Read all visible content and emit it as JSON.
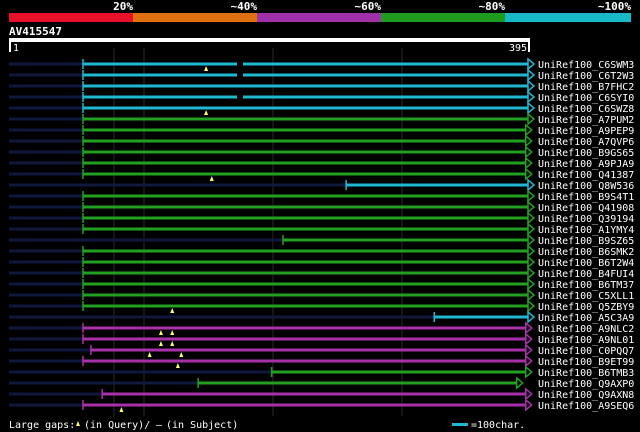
{
  "scale_bar": {
    "segments": [
      {
        "label": "20%",
        "color": "#e8102a"
      },
      {
        "label": "~40%",
        "color": "#e07010"
      },
      {
        "label": "~60%",
        "color": "#a030a8"
      },
      {
        "label": "~80%",
        "color": "#1e9a1e"
      },
      {
        "label": "~100%",
        "color": "#18b8c8"
      }
    ]
  },
  "query": {
    "id": "AV415547",
    "start": "1",
    "end": "395"
  },
  "colors": {
    "cyan": "#20b8d0",
    "green": "#22a022",
    "purple": "#a830a8",
    "navy": "#101840",
    "marker": "#ffff66",
    "grid": "#2a2a2a"
  },
  "hits": [
    {
      "name": "UniRef100_C6SWM3",
      "color": "cyan",
      "start": 1,
      "end": 395,
      "nav_from": 1,
      "marks": [
        [
          110,
          "tri"
        ],
        [
          140,
          "dash"
        ]
      ]
    },
    {
      "name": "UniRef100_C6T2W3",
      "color": "cyan",
      "start": 1,
      "end": 395,
      "nav_from": 1,
      "marks": [
        [
          140,
          "dash"
        ]
      ]
    },
    {
      "name": "UniRef100_B7FHC2",
      "color": "cyan",
      "start": 1,
      "end": 395,
      "nav_from": 1,
      "marks": []
    },
    {
      "name": "UniRef100_C6SYI0",
      "color": "cyan",
      "start": 1,
      "end": 395,
      "nav_from": 1,
      "marks": [
        [
          140,
          "dash"
        ]
      ]
    },
    {
      "name": "UniRef100_C6SWZ8",
      "color": "cyan",
      "start": 1,
      "end": 395,
      "nav_from": 1,
      "marks": [
        [
          110,
          "tri"
        ]
      ]
    },
    {
      "name": "UniRef100_A7PUM2",
      "color": "green",
      "start": 1,
      "end": 395,
      "nav_from": 1,
      "marks": []
    },
    {
      "name": "UniRef100_A9PEP9",
      "color": "green",
      "start": 1,
      "end": 393,
      "nav_from": 1,
      "marks": []
    },
    {
      "name": "UniRef100_A7QVP6",
      "color": "green",
      "start": 1,
      "end": 393,
      "nav_from": 1,
      "marks": []
    },
    {
      "name": "UniRef100_B9GS65",
      "color": "green",
      "start": 1,
      "end": 393,
      "nav_from": 1,
      "marks": []
    },
    {
      "name": "UniRef100_A9PJA9",
      "color": "green",
      "start": 1,
      "end": 393,
      "nav_from": 1,
      "marks": []
    },
    {
      "name": "UniRef100_Q41387",
      "color": "green",
      "start": 1,
      "end": 393,
      "nav_from": 1,
      "marks": [
        [
          115,
          "tri"
        ]
      ]
    },
    {
      "name": "UniRef100_Q8W536",
      "color": "cyan",
      "start": 234,
      "end": 395,
      "nav_from": 1,
      "marks": []
    },
    {
      "name": "UniRef100_B9S4T1",
      "color": "green",
      "start": 1,
      "end": 395,
      "nav_from": 1,
      "marks": []
    },
    {
      "name": "UniRef100_Q41908",
      "color": "green",
      "start": 1,
      "end": 395,
      "nav_from": 1,
      "marks": []
    },
    {
      "name": "UniRef100_Q39194",
      "color": "green",
      "start": 1,
      "end": 395,
      "nav_from": 1,
      "marks": []
    },
    {
      "name": "UniRef100_A1YMY4",
      "color": "green",
      "start": 1,
      "end": 395,
      "nav_from": 1,
      "marks": []
    },
    {
      "name": "UniRef100_B9SZ65",
      "color": "green",
      "start": 178,
      "end": 395,
      "nav_from": 1,
      "marks": []
    },
    {
      "name": "UniRef100_B6SMK2",
      "color": "green",
      "start": 1,
      "end": 395,
      "nav_from": 1,
      "marks": []
    },
    {
      "name": "UniRef100_B6T2W4",
      "color": "green",
      "start": 1,
      "end": 395,
      "nav_from": 1,
      "marks": []
    },
    {
      "name": "UniRef100_B4FUI4",
      "color": "green",
      "start": 1,
      "end": 395,
      "nav_from": 1,
      "marks": []
    },
    {
      "name": "UniRef100_B6TM37",
      "color": "green",
      "start": 1,
      "end": 395,
      "nav_from": 1,
      "marks": []
    },
    {
      "name": "UniRef100_C5XLL1",
      "color": "green",
      "start": 1,
      "end": 395,
      "nav_from": 1,
      "marks": []
    },
    {
      "name": "UniRef100_Q5ZBY9",
      "color": "green",
      "start": 1,
      "end": 395,
      "nav_from": 1,
      "marks": [
        [
          80,
          "tri"
        ]
      ]
    },
    {
      "name": "UniRef100_A5C3A9",
      "color": "cyan",
      "start": 312,
      "end": 395,
      "nav_from": 1,
      "marks": []
    },
    {
      "name": "UniRef100_A9NLC2",
      "color": "purple",
      "start": 1,
      "end": 393,
      "nav_from": 1,
      "marks": [
        [
          70,
          "tri"
        ],
        [
          80,
          "tri"
        ]
      ]
    },
    {
      "name": "UniRef100_A9NL01",
      "color": "purple",
      "start": 1,
      "end": 393,
      "nav_from": 1,
      "marks": [
        [
          70,
          "tri"
        ],
        [
          80,
          "tri"
        ]
      ]
    },
    {
      "name": "UniRef100_C0PQQ7",
      "color": "purple",
      "start": 8,
      "end": 393,
      "nav_from": 1,
      "marks": [
        [
          60,
          "tri"
        ],
        [
          88,
          "tri"
        ]
      ]
    },
    {
      "name": "UniRef100_B9ET99",
      "color": "purple",
      "start": 1,
      "end": 393,
      "nav_from": 1,
      "marks": [
        [
          85,
          "tri"
        ]
      ]
    },
    {
      "name": "UniRef100_B6TMB3",
      "color": "green",
      "start": 168,
      "end": 393,
      "nav_from": 1,
      "marks": []
    },
    {
      "name": "UniRef100_Q9AXP0",
      "color": "green",
      "start": 103,
      "end": 385,
      "nav_from": 1,
      "marks": []
    },
    {
      "name": "UniRef100_Q9AXN8",
      "color": "purple",
      "start": 18,
      "end": 393,
      "nav_from": 1,
      "marks": []
    },
    {
      "name": "UniRef100_A9SEQ6",
      "color": "purple",
      "start": 1,
      "end": 393,
      "nav_from": 1,
      "marks": [
        [
          35,
          "tri"
        ]
      ]
    }
  ],
  "legend": {
    "large_gaps_label": "Large gaps:",
    "in_query": "(in Query)/",
    "dash_sym": "–",
    "in_subject": "(in Subject)",
    "scale_label": "=100char."
  }
}
